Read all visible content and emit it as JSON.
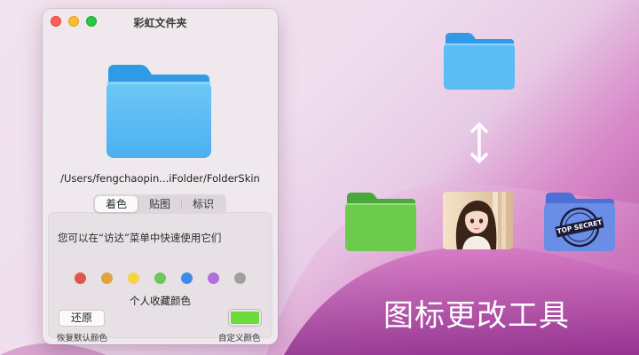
{
  "window": {
    "title": "彩虹文件夹",
    "path": "/Users/fengchaopin...iFolder/FolderSkin"
  },
  "tabs": [
    {
      "label": "着色",
      "active": true
    },
    {
      "label": "贴图",
      "active": false
    },
    {
      "label": "标识",
      "active": false
    }
  ],
  "panel": {
    "hint": "您可以在“访达”菜单中快速使用它们",
    "favorites_label": "个人收藏颜色",
    "favorite_colors": [
      "#e2554f",
      "#e0a340",
      "#f5d547",
      "#6cc85a",
      "#3f8ae8",
      "#b06ed9",
      "#a0a0a0"
    ],
    "restore_button": "还原",
    "restore_caption": "恢复默认颜色",
    "custom_caption": "自定义颜色",
    "custom_color": "#6edb3c"
  },
  "showcase": {
    "headline": "图标更改工具",
    "folder_colors": {
      "blue": "#5cbcf4",
      "green": "#6ccb4c",
      "purple": "#6a8de6"
    },
    "stamp_text": "TOP SECRET"
  }
}
